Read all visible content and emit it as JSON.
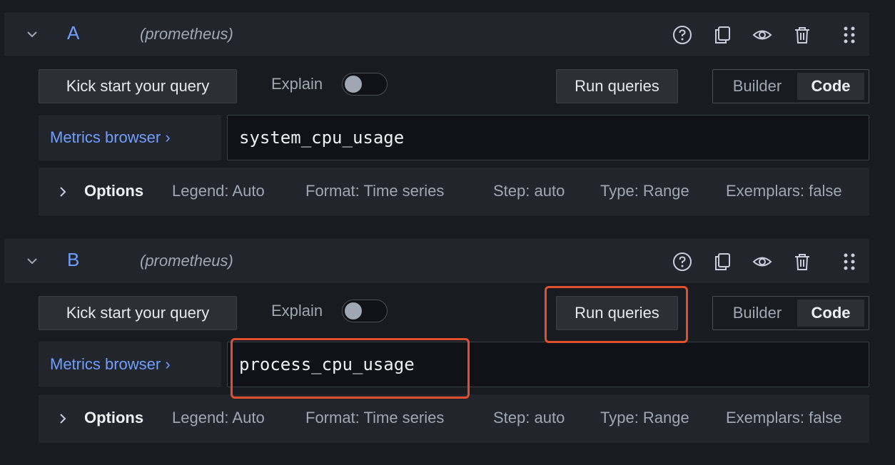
{
  "queries": [
    {
      "name": "A",
      "datasource": "(prometheus)",
      "kick_start_label": "Kick start your query",
      "explain_label": "Explain",
      "explain_on": false,
      "run_queries_label": "Run queries",
      "mode_options": [
        "Builder",
        "Code"
      ],
      "mode_selected": "Code",
      "metrics_browser_label": "Metrics browser ›",
      "query_text": "system_cpu_usage",
      "options_label": "Options",
      "options_summary": {
        "legend": "Legend: Auto",
        "format": "Format: Time series",
        "step": "Step: auto",
        "type": "Type: Range",
        "exemplars": "Exemplars: false"
      }
    },
    {
      "name": "B",
      "datasource": "(prometheus)",
      "kick_start_label": "Kick start your query",
      "explain_label": "Explain",
      "explain_on": false,
      "run_queries_label": "Run queries",
      "mode_options": [
        "Builder",
        "Code"
      ],
      "mode_selected": "Code",
      "metrics_browser_label": "Metrics browser ›",
      "query_text": "process_cpu_usage",
      "options_label": "Options",
      "options_summary": {
        "legend": "Legend: Auto",
        "format": "Format: Time series",
        "step": "Step: auto",
        "type": "Type: Range",
        "exemplars": "Exemplars: false"
      }
    }
  ],
  "header_icons": [
    "help-icon",
    "duplicate-icon",
    "eye-icon",
    "trash-icon",
    "drag-handle-icon"
  ],
  "colors": {
    "background": "#181b1f",
    "panel": "#22252b",
    "accent_blue": "#6e9fff",
    "highlight": "#e0502f"
  }
}
